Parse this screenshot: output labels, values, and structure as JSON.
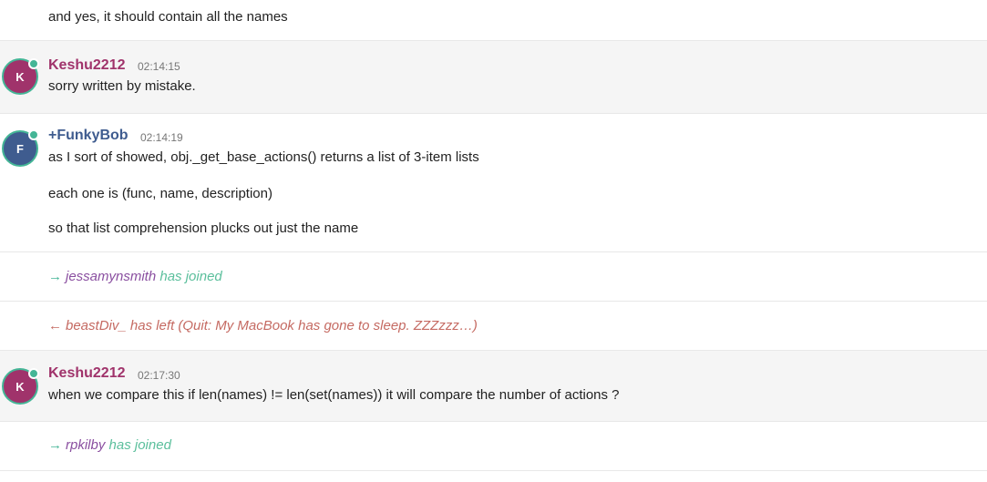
{
  "colors": {
    "online": "#44b596",
    "nick_keshu": "#a0336b",
    "nick_funkybob": "#3f5c8f",
    "join_user": "#8a4fa0",
    "join_text": "#5bbf9c",
    "part_text": "#c56a62"
  },
  "messages": [
    {
      "lines": [
        "and yes, it should contain all the names"
      ]
    },
    {
      "initial": "K",
      "nick": "Keshu2212",
      "time": "02:14:15",
      "lines": [
        "sorry written by mistake."
      ]
    },
    {
      "initial": "F",
      "nick": "+FunkyBob",
      "time": "02:14:19",
      "lines": [
        "as I sort of showed, obj._get_base_actions() returns a list of 3-item lists",
        "each one is (func, name, description)",
        "so that list comprehension plucks out just the name"
      ]
    },
    {
      "event": "join",
      "arrow": "→",
      "user": "jessamynsmith",
      "text": "has joined"
    },
    {
      "event": "part",
      "arrow": "←",
      "text": "beastDiv_  has left (Quit: My MacBook has gone to sleep. ZZZzzz…)"
    },
    {
      "initial": "K",
      "nick": "Keshu2212",
      "time": "02:17:30",
      "lines": [
        "when we compare this if len(names) != len(set(names)) it will compare the number of actions ?"
      ]
    },
    {
      "event": "join",
      "arrow": "→",
      "user": "rpkilby",
      "text": "has joined"
    }
  ]
}
